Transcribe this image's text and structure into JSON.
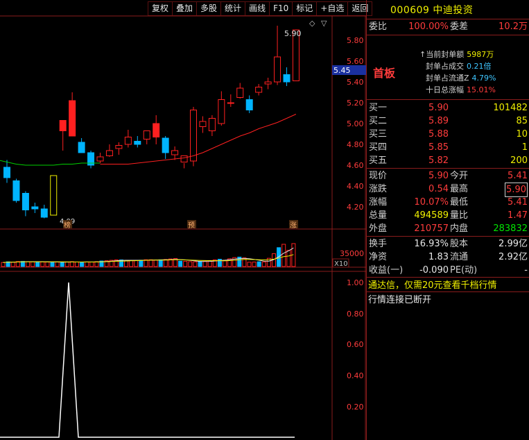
{
  "toolbar": {
    "items": [
      "复权",
      "叠加",
      "多股",
      "统计",
      "画线",
      "F10",
      "标记",
      "+自选",
      "返回"
    ]
  },
  "price_chart": {
    "y_ticks": [
      "5.80",
      "5.60",
      "5.40",
      "5.20",
      "5.00",
      "4.80",
      "4.60",
      "4.40",
      "4.20"
    ],
    "current_price_tag": "5.45",
    "high_label": "5.90",
    "low_label": "4.09",
    "event_tags": [
      "榜",
      "预",
      "涨"
    ],
    "colors": {
      "up": "#ff2020",
      "down": "#00b4ff",
      "ma": "#ff2020",
      "ma2": "#00d000"
    }
  },
  "chart_data": [
    {
      "type": "candlestick",
      "ylim": [
        4.1,
        5.98
      ],
      "candles": [
        {
          "o": 4.58,
          "h": 4.65,
          "l": 4.43,
          "c": 4.48
        },
        {
          "o": 4.45,
          "h": 4.47,
          "l": 4.24,
          "c": 4.26
        },
        {
          "o": 4.33,
          "h": 4.35,
          "l": 4.11,
          "c": 4.17
        },
        {
          "o": 4.2,
          "h": 4.24,
          "l": 4.14,
          "c": 4.18
        },
        {
          "o": 4.18,
          "h": 4.22,
          "l": 4.09,
          "c": 4.1
        },
        {
          "o": 4.12,
          "h": 4.5,
          "l": 4.12,
          "c": 4.5
        },
        {
          "o": 4.93,
          "h": 5.0,
          "l": 4.74,
          "c": 5.03
        },
        {
          "o": 4.88,
          "h": 5.3,
          "l": 4.88,
          "c": 5.22
        },
        {
          "o": 4.82,
          "h": 4.86,
          "l": 4.72,
          "c": 4.72
        },
        {
          "o": 4.72,
          "h": 4.74,
          "l": 4.57,
          "c": 4.6
        },
        {
          "o": 4.64,
          "h": 4.72,
          "l": 4.62,
          "c": 4.68
        },
        {
          "o": 4.69,
          "h": 4.8,
          "l": 4.68,
          "c": 4.74
        },
        {
          "o": 4.76,
          "h": 4.82,
          "l": 4.7,
          "c": 4.79
        },
        {
          "o": 4.8,
          "h": 4.94,
          "l": 4.77,
          "c": 4.87
        },
        {
          "o": 4.83,
          "h": 4.88,
          "l": 4.77,
          "c": 4.8
        },
        {
          "o": 4.85,
          "h": 4.93,
          "l": 4.8,
          "c": 4.93
        },
        {
          "o": 4.87,
          "h": 5.08,
          "l": 4.8,
          "c": 5.0
        },
        {
          "o": 4.86,
          "h": 4.88,
          "l": 4.66,
          "c": 4.72
        },
        {
          "o": 4.7,
          "h": 4.78,
          "l": 4.65,
          "c": 4.74
        },
        {
          "o": 4.63,
          "h": 4.62,
          "l": 4.57,
          "c": 4.69
        },
        {
          "o": 4.64,
          "h": 5.16,
          "l": 4.59,
          "c": 5.13
        },
        {
          "o": 4.97,
          "h": 5.07,
          "l": 4.91,
          "c": 5.02
        },
        {
          "o": 4.93,
          "h": 5.08,
          "l": 4.88,
          "c": 5.05
        },
        {
          "o": 5.0,
          "h": 5.31,
          "l": 4.98,
          "c": 5.23
        },
        {
          "o": 5.2,
          "h": 5.28,
          "l": 5.16,
          "c": 5.2
        },
        {
          "o": 5.25,
          "h": 5.39,
          "l": 5.24,
          "c": 5.34
        },
        {
          "o": 5.23,
          "h": 5.27,
          "l": 5.1,
          "c": 5.13
        },
        {
          "o": 5.3,
          "h": 5.38,
          "l": 5.27,
          "c": 5.35
        },
        {
          "o": 5.38,
          "h": 5.44,
          "l": 5.33,
          "c": 5.4
        },
        {
          "o": 5.4,
          "h": 5.94,
          "l": 5.37,
          "c": 5.64
        },
        {
          "o": 5.47,
          "h": 5.54,
          "l": 5.36,
          "c": 5.4
        },
        {
          "o": 5.41,
          "h": 5.9,
          "l": 5.41,
          "c": 5.9
        }
      ],
      "ma_red": [
        null,
        null,
        null,
        null,
        null,
        null,
        null,
        null,
        null,
        null,
        4.61,
        4.61,
        4.61,
        4.61,
        4.62,
        4.63,
        4.64,
        4.65,
        4.66,
        4.67,
        4.69,
        4.72,
        4.76,
        4.8,
        4.84,
        4.88,
        4.91,
        4.95,
        4.98,
        5.01,
        5.05,
        5.09
      ],
      "ma_green": [
        4.65,
        4.63,
        4.61,
        4.6,
        4.6,
        4.6,
        4.6,
        4.61,
        4.61,
        4.62,
        4.62,
        4.62
      ]
    },
    {
      "type": "bar",
      "name": "volume",
      "y_ticks": [
        "35000"
      ],
      "unit": "X10",
      "values": [
        3000,
        3500,
        3200,
        3700,
        3800,
        3600,
        3400,
        3500,
        3400,
        3300,
        3400,
        3300,
        3000,
        3400,
        3600,
        3400,
        3300,
        3400,
        3300,
        3600,
        4100,
        4300,
        4600,
        4900,
        4900,
        4400,
        4500,
        4600,
        4700,
        5000,
        5000,
        4800,
        5000,
        5200,
        5600,
        5900,
        4000,
        3900,
        3600,
        3500,
        3800,
        3900,
        4200,
        4900,
        5400,
        4700,
        5700,
        6600,
        7000,
        6400,
        3200,
        3300,
        3500,
        3400,
        6100,
        9500,
        14000,
        16500,
        12000,
        17000
      ]
    },
    {
      "type": "line",
      "name": "indicator",
      "y_ticks": [
        "1.00",
        "0.80",
        "0.60",
        "0.40",
        "0.20"
      ],
      "ylim": [
        0,
        1.05
      ],
      "values": [
        0,
        0,
        0,
        0,
        0,
        0,
        1,
        0,
        0,
        0,
        0,
        0,
        0,
        0,
        0,
        0,
        0,
        0,
        0,
        0,
        0,
        0,
        0,
        0,
        0,
        0,
        0,
        0,
        0,
        0,
        0,
        0
      ]
    }
  ],
  "panel": {
    "ticker": "000609 中迪投资",
    "weibi_label": "委比",
    "weibi_value": "100.00%",
    "weicha_label": "委差",
    "weicha_value": "10.2万",
    "board": "首板",
    "seal": [
      {
        "label": "当前封单额",
        "value": "5987万",
        "mark": "↑"
      },
      {
        "label": "封单占成交",
        "value": "0.21倍"
      },
      {
        "label": "封单占流通Z",
        "value": "4.79%"
      },
      {
        "label": "十日总涨幅",
        "value": "15.01%"
      }
    ],
    "bids": [
      {
        "label": "买一",
        "price": "5.90",
        "vol": "101482"
      },
      {
        "label": "买二",
        "price": "5.89",
        "vol": "85"
      },
      {
        "label": "买三",
        "price": "5.88",
        "vol": "10"
      },
      {
        "label": "买四",
        "price": "5.85",
        "vol": "1"
      },
      {
        "label": "买五",
        "price": "5.82",
        "vol": "200"
      }
    ],
    "quote": [
      {
        "l1": "现价",
        "v1": "5.90",
        "l2": "今开",
        "v2": "5.41"
      },
      {
        "l1": "涨跌",
        "v1": "0.54",
        "l2": "最高",
        "v2": "5.90"
      },
      {
        "l1": "涨幅",
        "v1": "10.07%",
        "l2": "最低",
        "v2": "5.41"
      },
      {
        "l1": "总量",
        "v1": "494589",
        "l2": "量比",
        "v2": "1.47"
      },
      {
        "l1": "外盘",
        "v1": "210757",
        "l2": "内盘",
        "v2": "283832"
      }
    ],
    "fin": [
      {
        "l1": "换手",
        "v1": "16.93%",
        "l2": "股本",
        "v2": "2.99亿"
      },
      {
        "l1": "净资",
        "v1": "1.83",
        "l2": "流通",
        "v2": "2.92亿"
      },
      {
        "l1": "收益(一)",
        "v1": "-0.090",
        "l2": "PE(动)",
        "v2": "-"
      }
    ],
    "msg1": "通达信，仅需20元查看千档行情",
    "msg2": "行情连接已断开"
  }
}
